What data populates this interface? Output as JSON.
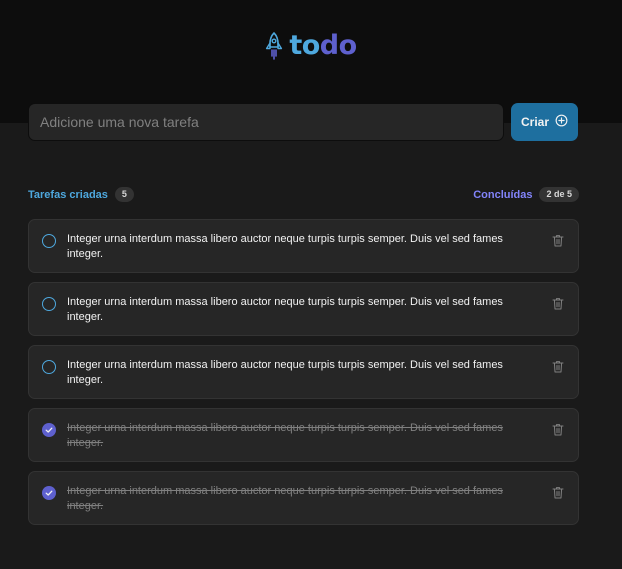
{
  "app": {
    "logo": {
      "part1": "to",
      "part2": "do"
    },
    "icons": {
      "logo": "rocket-icon",
      "create": "plus-circle-icon",
      "delete": "trash-icon",
      "check": "check-icon"
    },
    "colors": {
      "blue": "#4ea8de",
      "purple": "#5e60ce",
      "purple_light": "#8284fa",
      "button": "#1e6f9f",
      "background": "#1a1a1a",
      "header": "#0d0d0d",
      "card": "#262626"
    }
  },
  "new_task": {
    "placeholder": "Adicione uma nova tarefa",
    "value": "",
    "button_label": "Criar"
  },
  "counters": {
    "created_label": "Tarefas criadas",
    "created_count": "5",
    "done_label": "Concluídas",
    "done_count": "2 de 5"
  },
  "tasks": [
    {
      "text": "Integer urna interdum massa libero auctor neque turpis turpis semper. Duis vel sed fames integer.",
      "done": false
    },
    {
      "text": "Integer urna interdum massa libero auctor neque turpis turpis semper. Duis vel sed fames integer.",
      "done": false
    },
    {
      "text": "Integer urna interdum massa libero auctor neque turpis turpis semper. Duis vel sed fames integer.",
      "done": false
    },
    {
      "text": "Integer urna interdum massa libero auctor neque turpis turpis semper. Duis vel sed fames integer.",
      "done": true
    },
    {
      "text": "Integer urna interdum massa libero auctor neque turpis turpis semper. Duis vel sed fames integer.",
      "done": true
    }
  ]
}
